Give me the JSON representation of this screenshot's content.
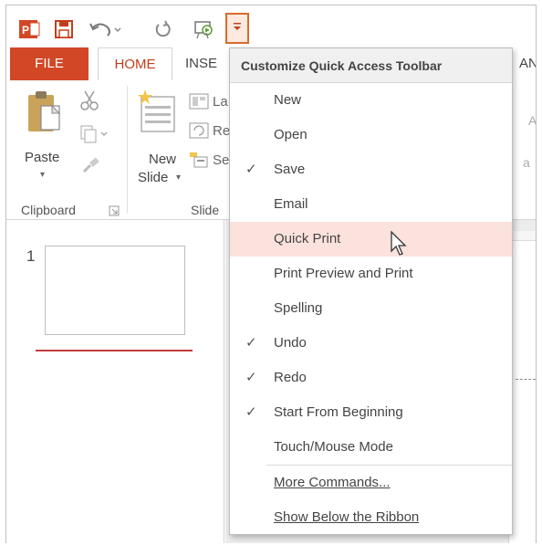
{
  "tabs": {
    "file": "FILE",
    "home": "HOME",
    "insert_partial": "INSE",
    "anim_partial": "AN"
  },
  "ribbon": {
    "paste": "Paste",
    "clipboard": "Clipboard",
    "new_slide_line1": "New",
    "new_slide_line2": "Slide",
    "slides_partial": "Slide",
    "layout_partial": "La",
    "reset_partial": "Re",
    "section_partial": "Se",
    "font_partial": "A",
    "font_partial2": "a"
  },
  "thumbnail": {
    "number": "1"
  },
  "menu": {
    "title": "Customize Quick Access Toolbar",
    "items": [
      {
        "label": "New",
        "checked": false,
        "highlighted": false
      },
      {
        "label": "Open",
        "checked": false,
        "highlighted": false
      },
      {
        "label": "Save",
        "checked": true,
        "highlighted": false
      },
      {
        "label": "Email",
        "checked": false,
        "highlighted": false
      },
      {
        "label": "Quick Print",
        "checked": false,
        "highlighted": true
      },
      {
        "label": "Print Preview and Print",
        "checked": false,
        "highlighted": false
      },
      {
        "label": "Spelling",
        "checked": false,
        "highlighted": false
      },
      {
        "label": "Undo",
        "checked": true,
        "highlighted": false
      },
      {
        "label": "Redo",
        "checked": true,
        "highlighted": false
      },
      {
        "label": "Start From Beginning",
        "checked": true,
        "highlighted": false
      },
      {
        "label": "Touch/Mouse Mode",
        "checked": false,
        "highlighted": false
      }
    ],
    "more_commands": "More Commands...",
    "show_below": "Show Below the Ribbon",
    "check_glyph": "✓"
  },
  "colors": {
    "accent": "#d24726",
    "highlight": "#fbe2dc",
    "selected_border": "#d76b2b"
  },
  "icons": {
    "app": "powerpoint-icon",
    "save": "save-icon",
    "undo": "undo-icon",
    "redo": "redo-icon",
    "start": "start-from-beginning-icon",
    "customize": "customize-qat-dropdown-icon"
  }
}
